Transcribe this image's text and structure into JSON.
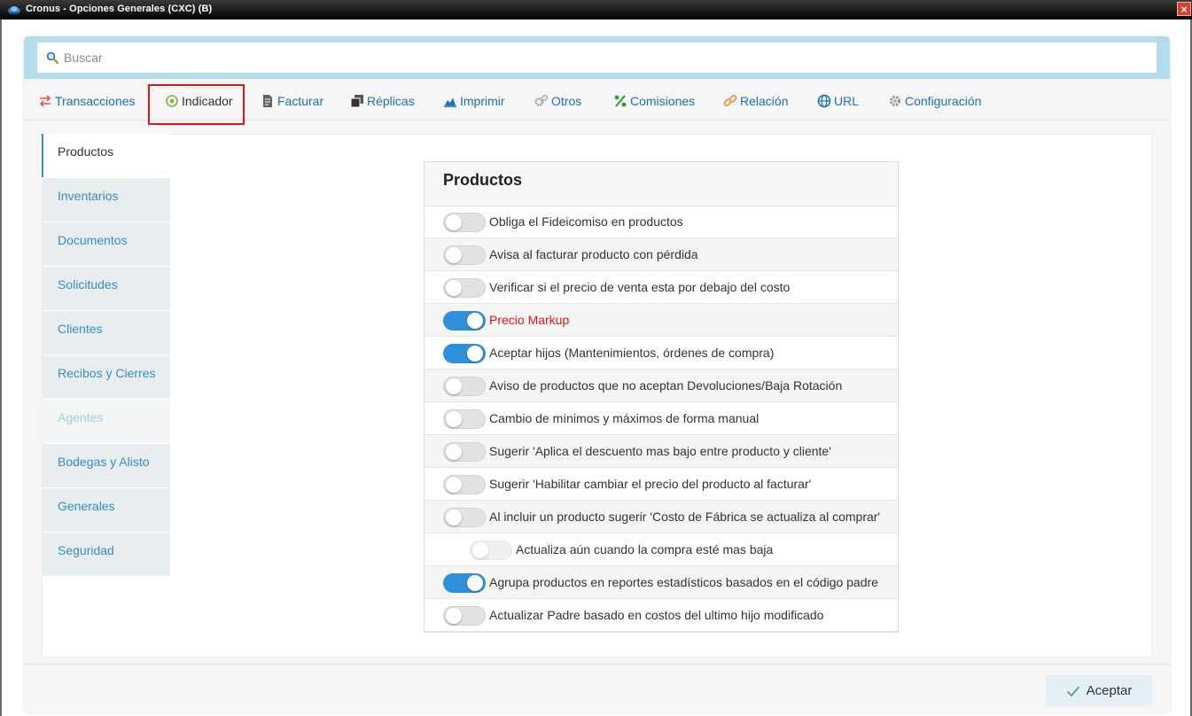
{
  "window": {
    "title": "Cronus - Opciones Generales (CXC) (B)",
    "close_label": "×"
  },
  "search": {
    "placeholder": "Buscar",
    "value": ""
  },
  "tabs": [
    {
      "label": "Transacciones",
      "icon": "exchange-icon",
      "color": "#e4534e"
    },
    {
      "label": "Indicador",
      "icon": "target-icon",
      "color": "#7cb342"
    },
    {
      "label": "Facturar",
      "icon": "document-icon",
      "color": "#555555"
    },
    {
      "label": "Réplicas",
      "icon": "copy-icon",
      "color": "#444444"
    },
    {
      "label": "Imprimir",
      "icon": "chart-icon",
      "color": "#1d70b7"
    },
    {
      "label": "Otros",
      "icon": "cogs-icon",
      "color": "#9e9e9e"
    },
    {
      "label": "Comisiones",
      "icon": "percent-icon",
      "color": "#2e9a3a"
    },
    {
      "label": "Relación",
      "icon": "link-icon",
      "color": "#e0a060"
    },
    {
      "label": "URL",
      "icon": "globe-icon",
      "color": "#1d70b7"
    },
    {
      "label": "Configuración",
      "icon": "gear-icon",
      "color": "#9e9e9e"
    }
  ],
  "active_tab": "Indicador",
  "sidebar": {
    "items": [
      {
        "label": "Productos",
        "state": "active"
      },
      {
        "label": "Inventarios",
        "state": "normal"
      },
      {
        "label": "Documentos",
        "state": "normal"
      },
      {
        "label": "Solicitudes",
        "state": "normal"
      },
      {
        "label": "Clientes",
        "state": "normal"
      },
      {
        "label": "Recibos y Cierres",
        "state": "normal"
      },
      {
        "label": "Agentes",
        "state": "disabled"
      },
      {
        "label": "Bodegas y Alisto",
        "state": "normal"
      },
      {
        "label": "Generales",
        "state": "normal"
      },
      {
        "label": "Seguridad",
        "state": "normal"
      }
    ]
  },
  "panel": {
    "title": "Productos",
    "options": [
      {
        "label": "Obliga el Fideicomiso en productos",
        "on": false
      },
      {
        "label": "Avisa al facturar producto con pérdida",
        "on": false
      },
      {
        "label": "Verificar si el precio de venta esta por debajo del costo",
        "on": false
      },
      {
        "label": "Precio Markup",
        "on": true,
        "highlight": true
      },
      {
        "label": "Aceptar hijos (Mantenimientos, órdenes de compra)",
        "on": true
      },
      {
        "label": "Aviso de productos que no aceptan Devoluciones/Baja Rotación",
        "on": false
      },
      {
        "label": "Cambio de mínimos y máximos de forma manual",
        "on": false
      },
      {
        "label": "Sugerir 'Aplica el descuento mas bajo entre producto y cliente'",
        "on": false
      },
      {
        "label": "Sugerir 'Habilitar cambiar el precio del producto al facturar'",
        "on": false
      },
      {
        "label": "Al incluir un producto sugerir 'Costo de Fábrica se actualiza al comprar'",
        "on": false
      },
      {
        "label": "Actualiza aún cuando la compra esté mas baja",
        "on": false,
        "indented": true,
        "disabled": true
      },
      {
        "label": "Agrupa productos en reportes estadísticos basados en el código padre",
        "on": true
      },
      {
        "label": "Actualizar Padre basado en costos del ultimo hijo modificado",
        "on": false
      }
    ]
  },
  "footer": {
    "ok_label": "Aceptar",
    "ok_icon": "check-icon"
  }
}
